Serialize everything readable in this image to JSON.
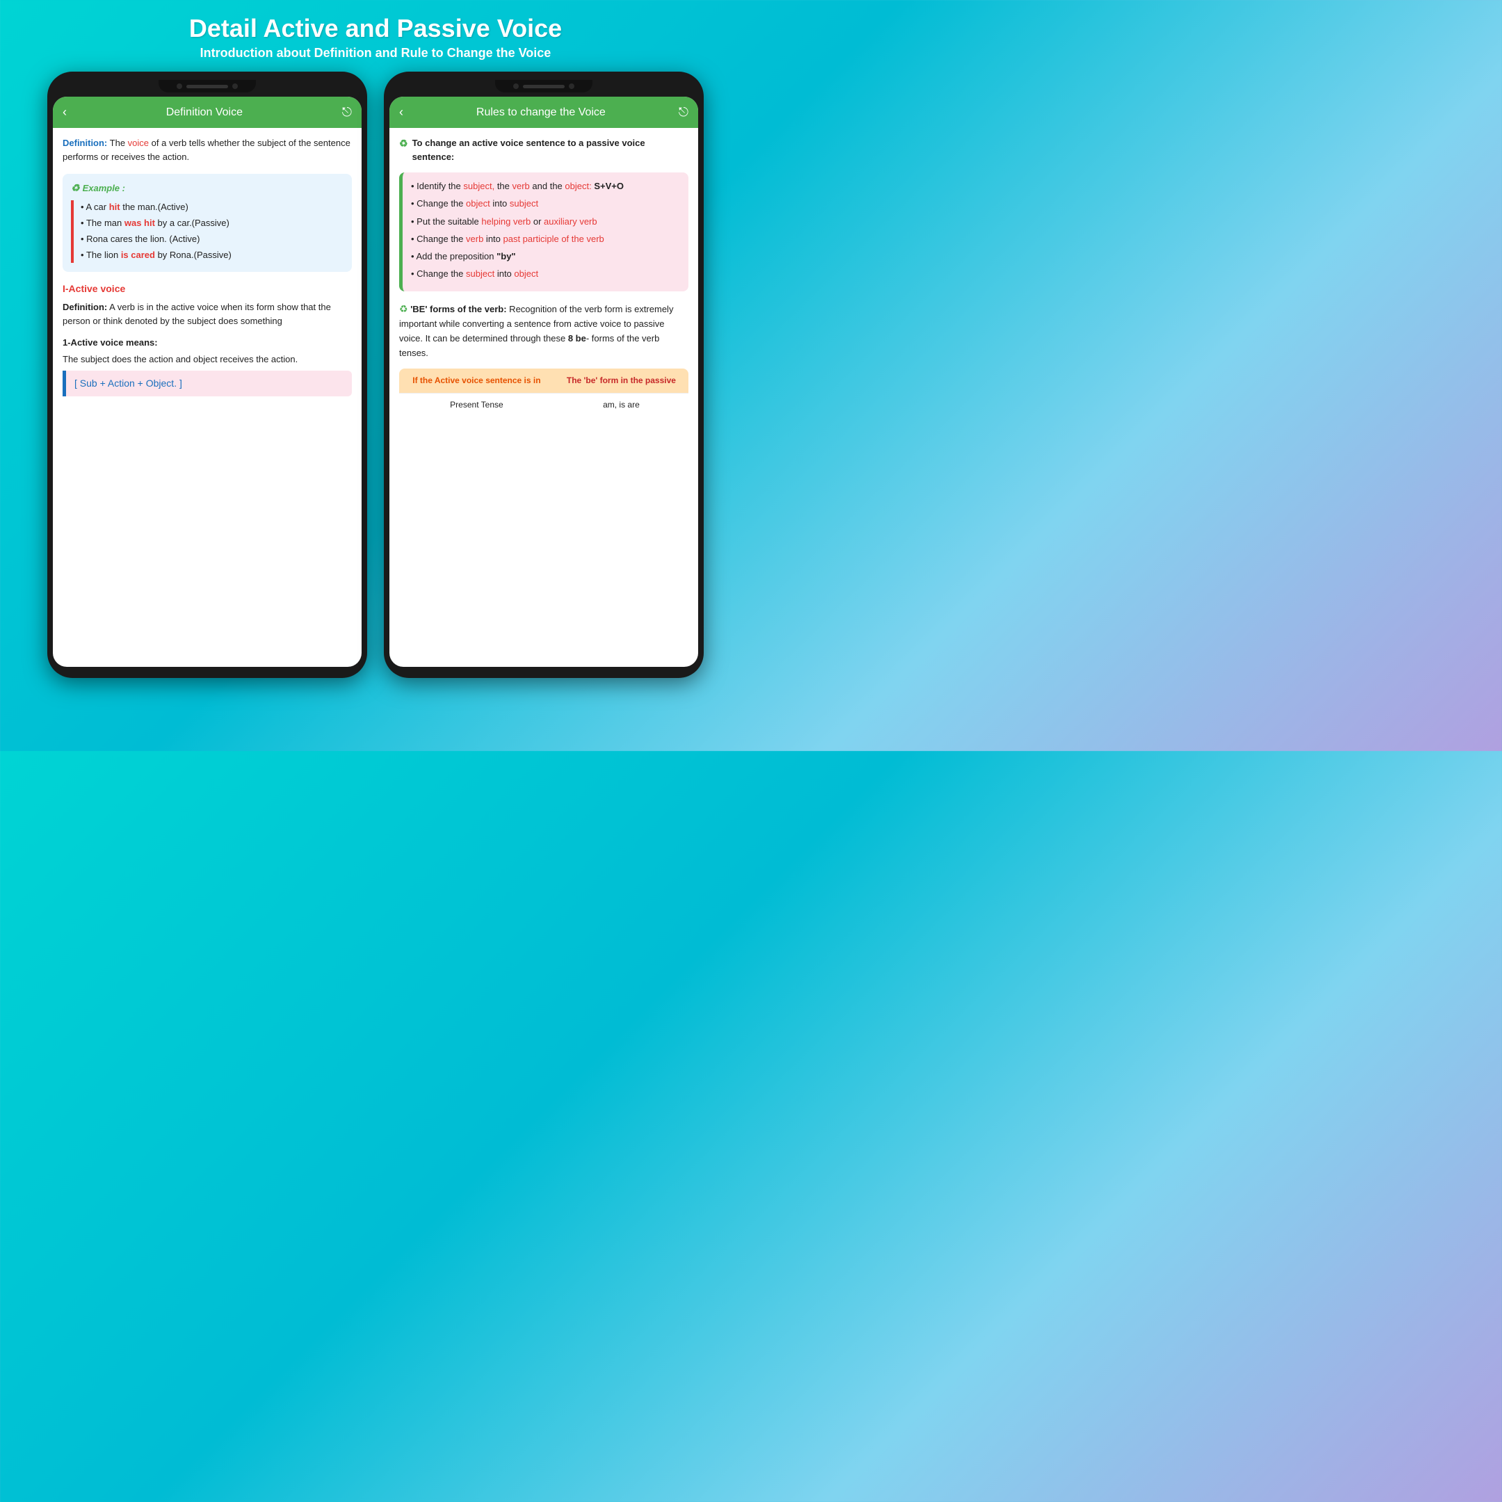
{
  "page": {
    "title": "Detail Active and Passive Voice",
    "subtitle": "Introduction about Definition and Rule to Change the Voice"
  },
  "left_phone": {
    "header": {
      "back_icon": "‹",
      "title": "Definition Voice",
      "share_icon": "⎋"
    },
    "definition": {
      "label": "Definition:",
      "text_before": " The ",
      "word_voice": "voice",
      "text_after": " of a verb tells whether the subject of the sentence performs or receives the action."
    },
    "example": {
      "title": "Example :",
      "items": [
        {
          "text": "A car ",
          "word": "hit",
          "rest": " the man.(Active)"
        },
        {
          "text": "The man ",
          "word": "was hit",
          "rest": " by a car.(Passive)"
        },
        {
          "text": "Rona cares the lion. (Active)",
          "word": "",
          "rest": ""
        },
        {
          "text": "The lion ",
          "word": "is cared",
          "rest": " by Rona.(Passive)"
        }
      ]
    },
    "section_heading": "I-Active voice",
    "section_def_label": "Definition:",
    "section_def_text": " A verb is in the active voice when its form show that the person or think denoted by the subject does something",
    "sub_heading": "1-Active voice means:",
    "sub_text": "The subject does the action and object receives the action.",
    "formula": "[ Sub + Action + Object. ]"
  },
  "right_phone": {
    "header": {
      "back_icon": "‹",
      "title": "Rules to change the Voice",
      "share_icon": "⎋"
    },
    "intro_text": "To change an active voice sentence to a passive voice sentence:",
    "rules": [
      {
        "before": "Identify the ",
        "word1": "subject,",
        "middle": " the ",
        "word2": "verb",
        "after": " and the ",
        "word3": "object:",
        "bold": " S+V+O"
      },
      {
        "before": "Change the ",
        "word1": "object",
        "middle": " into ",
        "word2": "subject",
        "after": ""
      },
      {
        "before": "Put the suitable ",
        "word1": "helping verb",
        "middle": "  or ",
        "word2": "auxiliary verb",
        "after": ""
      },
      {
        "before": "Change the ",
        "word1": "verb",
        "middle": " into ",
        "word2": "past participle of the verb",
        "after": ""
      },
      {
        "before": "Add the preposition ",
        "word1": "\"by\"",
        "middle": "",
        "word2": "",
        "after": ""
      },
      {
        "before": "Change the ",
        "word1": "subject",
        "middle": " into ",
        "word2": "object",
        "after": ""
      }
    ],
    "be_forms_label": "'BE' forms of the verb:",
    "be_forms_text": " Recognition of the verb form is extremely important while converting a sentence from active voice to passive voice. It can be determined through these ",
    "be_forms_bold": "8 be",
    "be_forms_end": "- forms of the verb tenses.",
    "table": {
      "col1_header": "If the Active voice sentence is in",
      "col2_header": "The 'be' form in the passive",
      "rows": [
        {
          "col1": "Present Tense",
          "col2": "am, is are"
        }
      ]
    }
  }
}
